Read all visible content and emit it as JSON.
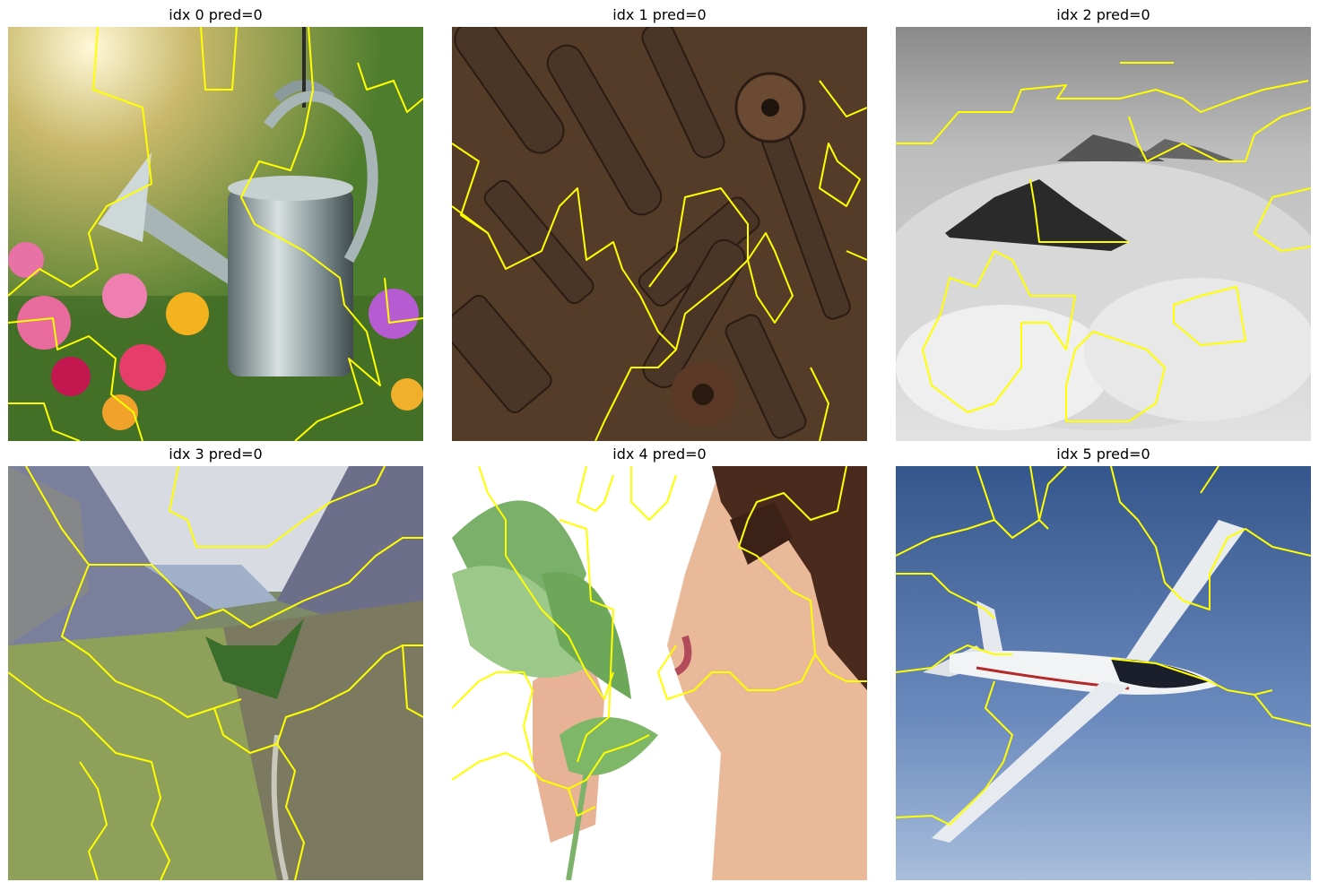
{
  "figure": {
    "panels": [
      {
        "title": "idx 0 pred=0",
        "subject": "watering can hanging over garden flowers"
      },
      {
        "title": "idx 1 pred=0",
        "subject": "rusty tools and gears on wooden table"
      },
      {
        "title": "idx 2 pred=0",
        "subject": "grayscale mountain peaks above clouds"
      },
      {
        "title": "idx 3 pred=0",
        "subject": "green mountain valley with river"
      },
      {
        "title": "idx 4 pred=0",
        "subject": "woman smelling a green leaf"
      },
      {
        "title": "idx 5 pred=0",
        "subject": "glider airplane in blue sky"
      }
    ]
  },
  "colors": {
    "boundary": "#ffff00",
    "background": "#ffffff"
  }
}
